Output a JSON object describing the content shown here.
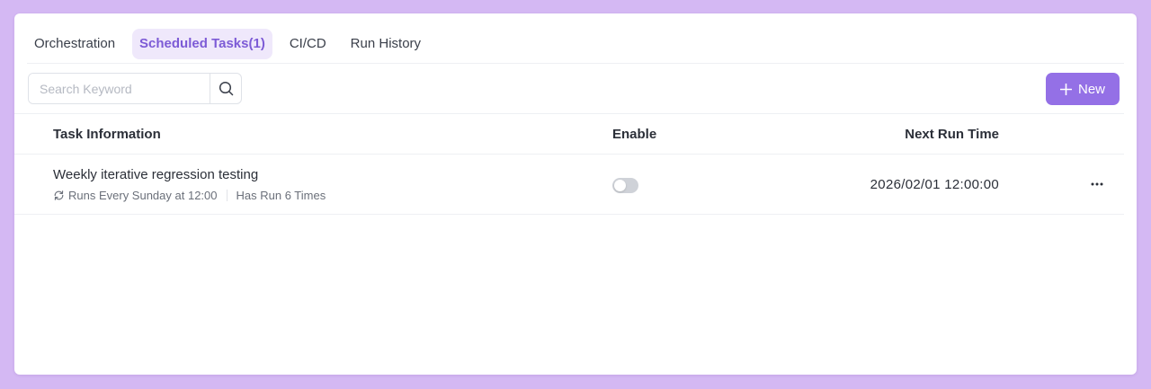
{
  "tabs": [
    {
      "label": "Orchestration",
      "active": false
    },
    {
      "label": "Scheduled Tasks(1)",
      "active": true
    },
    {
      "label": "CI/CD",
      "active": false
    },
    {
      "label": "Run History",
      "active": false
    }
  ],
  "search": {
    "placeholder": "Search Keyword",
    "value": "",
    "icon": "search-icon"
  },
  "toolbar": {
    "new_label": "New",
    "new_icon": "plus-icon"
  },
  "table": {
    "columns": {
      "info": "Task Information",
      "enable": "Enable",
      "next_run": "Next Run Time"
    },
    "rows": [
      {
        "name": "Weekly iterative regression testing",
        "schedule": "Runs Every Sunday at 12:00",
        "run_count": "Has Run 6 Times",
        "enabled": false,
        "next_run_time": "2026/02/01 12:00:00",
        "actions_icon": "more-horizontal-icon"
      }
    ]
  },
  "colors": {
    "accent": "#9470e6",
    "tab_active_bg": "#efe8fb",
    "tab_active_text": "#7d5bd6",
    "background": "#d4b8f3"
  }
}
